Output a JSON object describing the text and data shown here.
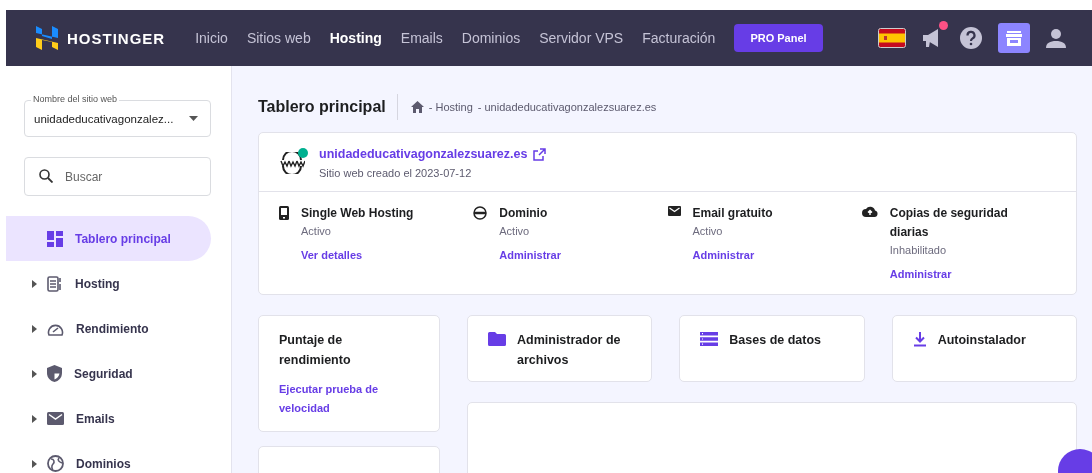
{
  "brand": "HOSTINGER",
  "nav": [
    {
      "label": "Inicio",
      "selected": false
    },
    {
      "label": "Sitios web",
      "selected": false
    },
    {
      "label": "Hosting",
      "selected": true
    },
    {
      "label": "Emails",
      "selected": false
    },
    {
      "label": "Dominios",
      "selected": false
    },
    {
      "label": "Servidor VPS",
      "selected": false
    },
    {
      "label": "Facturación",
      "selected": false
    }
  ],
  "pro_button": "PRO Panel",
  "notification_dot": true,
  "sidebar": {
    "site_select": {
      "label": "Nombre del sitio web",
      "value": "unidadeducativagonzalez..."
    },
    "search": {
      "placeholder": "Buscar"
    },
    "items": [
      {
        "label": "Tablero principal",
        "selected": true,
        "expandable": false
      },
      {
        "label": "Hosting",
        "selected": false,
        "expandable": true
      },
      {
        "label": "Rendimiento",
        "selected": false,
        "expandable": true
      },
      {
        "label": "Seguridad",
        "selected": false,
        "expandable": true
      },
      {
        "label": "Emails",
        "selected": false,
        "expandable": true
      },
      {
        "label": "Dominios",
        "selected": false,
        "expandable": true
      }
    ]
  },
  "header": {
    "title": "Tablero principal",
    "breadcrumb": [
      "- Hosting",
      "- unidadeducativagonzalezsuarez.es"
    ]
  },
  "site": {
    "domain": "unidadeducativagonzalezsuarez.es",
    "created": "Sitio web creado el 2023-07-12",
    "online": true,
    "services": [
      {
        "title": "Single Web Hosting",
        "status": "Activo",
        "link": "Ver detalles"
      },
      {
        "title": "Dominio",
        "status": "Activo",
        "link": "Administrar"
      },
      {
        "title": "Email gratuito",
        "status": "Activo",
        "link": "Administrar"
      },
      {
        "title": "Copias de seguridad diarias",
        "status": "Inhabilitado",
        "link": "Administrar"
      }
    ]
  },
  "performance": {
    "title": "Puntaje de rendimiento",
    "link": "Ejecutar prueba de velocidad"
  },
  "tools": [
    {
      "label": "Administrador de archivos"
    },
    {
      "label": "Bases de datos"
    },
    {
      "label": "Autoinstalador"
    }
  ]
}
